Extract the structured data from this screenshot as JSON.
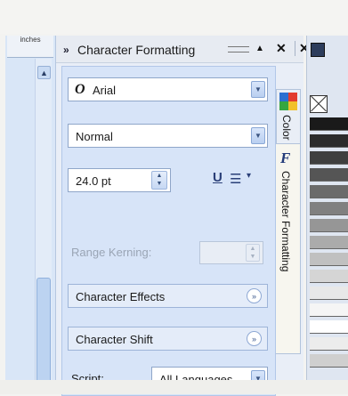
{
  "ruler": {
    "units_label": "inches"
  },
  "docker": {
    "title": "Character Formatting",
    "grip_glyph": "»",
    "pin_glyph": "▲",
    "close_glyph": "✕",
    "outer_close_glyph": "✕"
  },
  "font": {
    "name": "Arial",
    "glyph": "O"
  },
  "style": {
    "value": "Normal"
  },
  "size": {
    "value": "24.0 pt"
  },
  "kerning": {
    "label": "Range Kerning:"
  },
  "sections": {
    "effects": "Character Effects",
    "shift": "Character Shift"
  },
  "script": {
    "label": "Script:",
    "value": "All Languages"
  },
  "tabs": {
    "color": "Color",
    "character_formatting": "Character Formatting"
  },
  "colors": {
    "swatches": [
      "#1a1a1a",
      "#2c2c2c",
      "#3f3f3f",
      "#555555",
      "#6b6b6b",
      "#808080",
      "#969696",
      "#ababab",
      "#c0c0c0",
      "#d5d5d5",
      "#e8e8e8",
      "#f5f5f5",
      "#ffffff",
      "#ececec",
      "#cfcfcf"
    ]
  }
}
